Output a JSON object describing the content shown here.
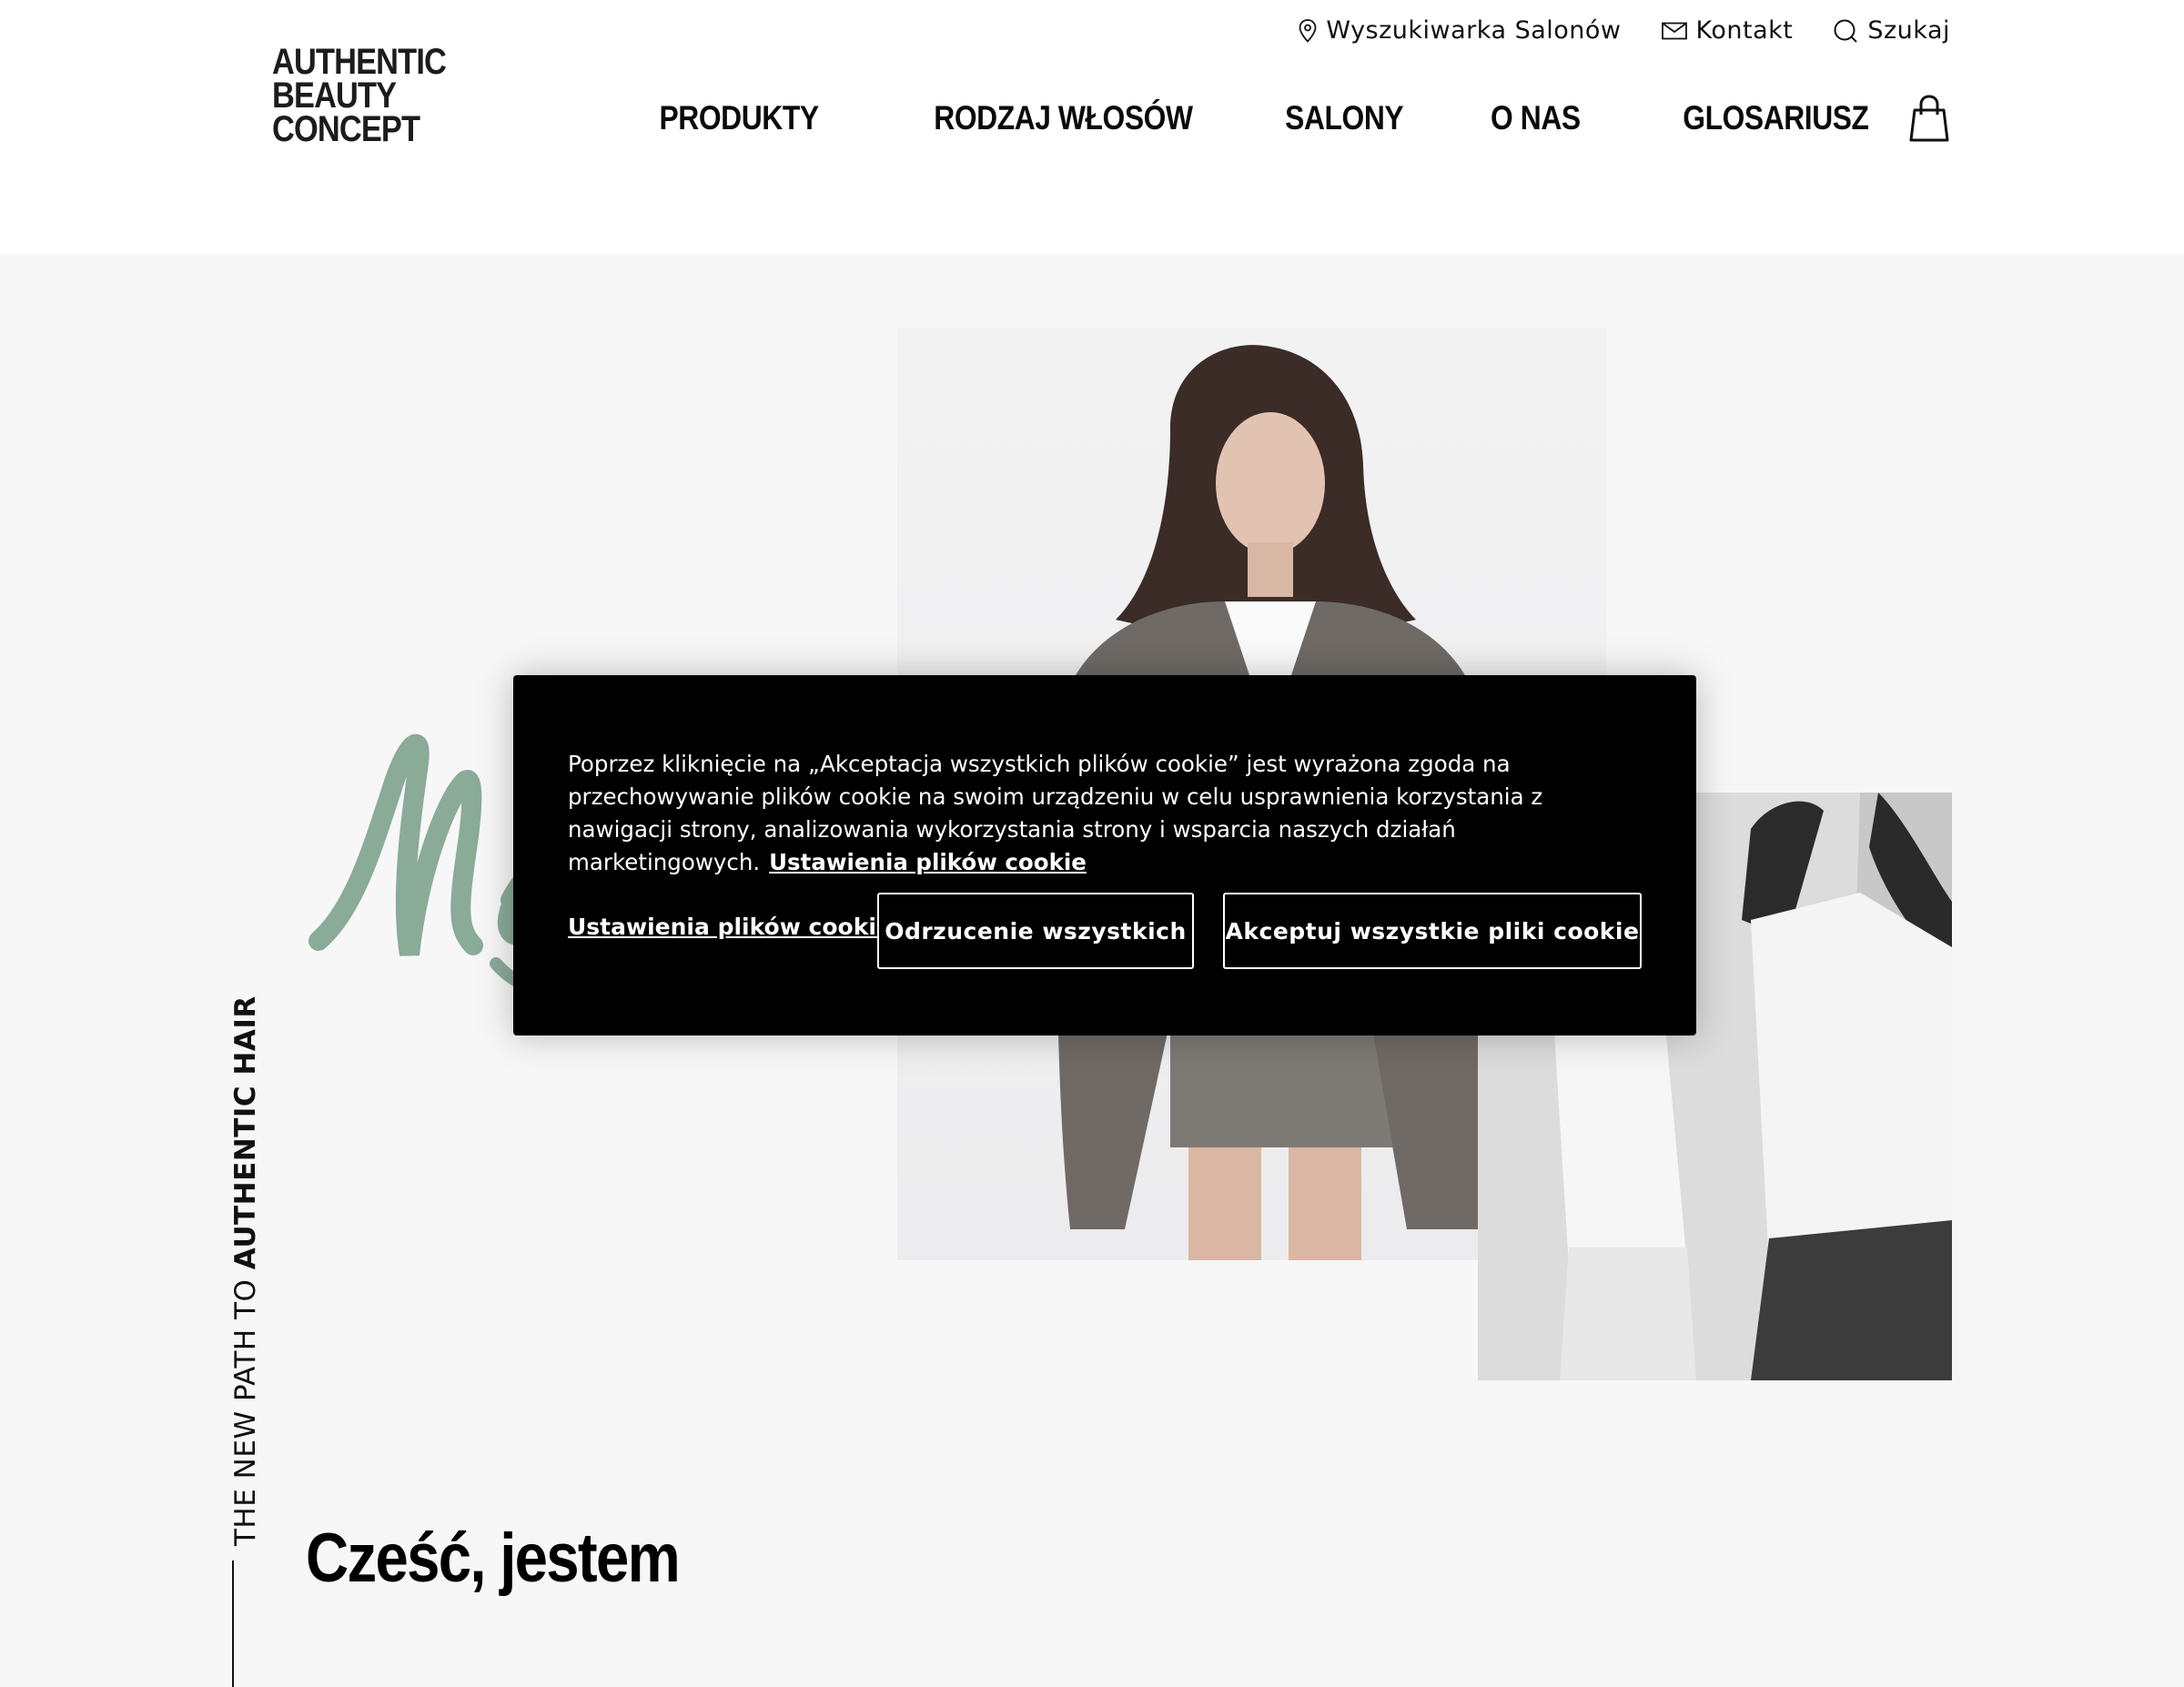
{
  "brand": {
    "logo_lines": [
      "AUTHENTIC",
      "BEAUTY",
      "CONCEPT"
    ]
  },
  "utility_nav": [
    {
      "label": "Wyszukiwarka Salonów",
      "icon": "location-pin-icon"
    },
    {
      "label": "Kontakt",
      "icon": "envelope-icon"
    },
    {
      "label": "Szukaj",
      "icon": "search-icon"
    }
  ],
  "main_nav": [
    "PRODUKTY",
    "RODZAJ WŁOSÓW",
    "SALONY",
    "O NAS",
    "GLOSARIUSZ"
  ],
  "hero": {
    "tagline_light": "THE NEW PATH TO ",
    "tagline_bold": "AUTHENTIC HAIR",
    "greeting": "Cześć, jestem",
    "script_color": "#8aab98"
  },
  "cookie": {
    "text": "Poprzez kliknięcie na „Akceptacja wszystkich plików cookie” jest wyrażona zgoda na przechowywanie plików cookie na swoim urządzeniu w celu usprawnienia korzystania z nawigacji strony, analizowania wykorzystania strony i wsparcia naszych działań marketingowych.",
    "inline_link": "Ustawienia plików cookie",
    "settings_link": "Ustawienia plików cookie",
    "reject_label": "Odrzucenie wszystkich",
    "accept_label": "Akceptuj wszystkie pliki cookie"
  }
}
